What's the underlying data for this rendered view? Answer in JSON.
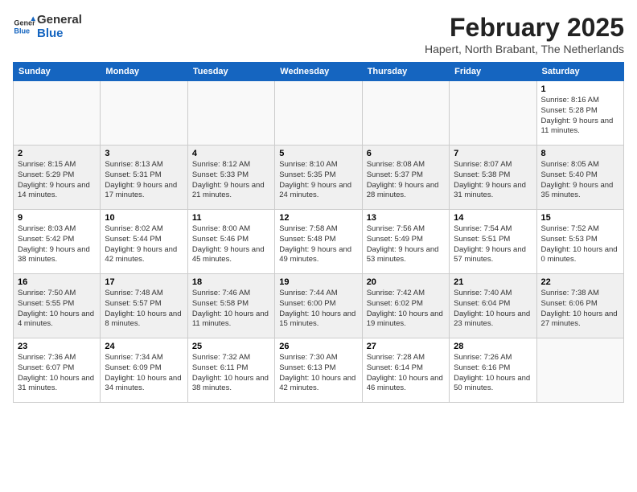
{
  "header": {
    "logo_line1": "General",
    "logo_line2": "Blue",
    "month_title": "February 2025",
    "location": "Hapert, North Brabant, The Netherlands"
  },
  "days_of_week": [
    "Sunday",
    "Monday",
    "Tuesday",
    "Wednesday",
    "Thursday",
    "Friday",
    "Saturday"
  ],
  "weeks": [
    [
      {
        "day": "",
        "info": ""
      },
      {
        "day": "",
        "info": ""
      },
      {
        "day": "",
        "info": ""
      },
      {
        "day": "",
        "info": ""
      },
      {
        "day": "",
        "info": ""
      },
      {
        "day": "",
        "info": ""
      },
      {
        "day": "1",
        "info": "Sunrise: 8:16 AM\nSunset: 5:28 PM\nDaylight: 9 hours and 11 minutes."
      }
    ],
    [
      {
        "day": "2",
        "info": "Sunrise: 8:15 AM\nSunset: 5:29 PM\nDaylight: 9 hours and 14 minutes."
      },
      {
        "day": "3",
        "info": "Sunrise: 8:13 AM\nSunset: 5:31 PM\nDaylight: 9 hours and 17 minutes."
      },
      {
        "day": "4",
        "info": "Sunrise: 8:12 AM\nSunset: 5:33 PM\nDaylight: 9 hours and 21 minutes."
      },
      {
        "day": "5",
        "info": "Sunrise: 8:10 AM\nSunset: 5:35 PM\nDaylight: 9 hours and 24 minutes."
      },
      {
        "day": "6",
        "info": "Sunrise: 8:08 AM\nSunset: 5:37 PM\nDaylight: 9 hours and 28 minutes."
      },
      {
        "day": "7",
        "info": "Sunrise: 8:07 AM\nSunset: 5:38 PM\nDaylight: 9 hours and 31 minutes."
      },
      {
        "day": "8",
        "info": "Sunrise: 8:05 AM\nSunset: 5:40 PM\nDaylight: 9 hours and 35 minutes."
      }
    ],
    [
      {
        "day": "9",
        "info": "Sunrise: 8:03 AM\nSunset: 5:42 PM\nDaylight: 9 hours and 38 minutes."
      },
      {
        "day": "10",
        "info": "Sunrise: 8:02 AM\nSunset: 5:44 PM\nDaylight: 9 hours and 42 minutes."
      },
      {
        "day": "11",
        "info": "Sunrise: 8:00 AM\nSunset: 5:46 PM\nDaylight: 9 hours and 45 minutes."
      },
      {
        "day": "12",
        "info": "Sunrise: 7:58 AM\nSunset: 5:48 PM\nDaylight: 9 hours and 49 minutes."
      },
      {
        "day": "13",
        "info": "Sunrise: 7:56 AM\nSunset: 5:49 PM\nDaylight: 9 hours and 53 minutes."
      },
      {
        "day": "14",
        "info": "Sunrise: 7:54 AM\nSunset: 5:51 PM\nDaylight: 9 hours and 57 minutes."
      },
      {
        "day": "15",
        "info": "Sunrise: 7:52 AM\nSunset: 5:53 PM\nDaylight: 10 hours and 0 minutes."
      }
    ],
    [
      {
        "day": "16",
        "info": "Sunrise: 7:50 AM\nSunset: 5:55 PM\nDaylight: 10 hours and 4 minutes."
      },
      {
        "day": "17",
        "info": "Sunrise: 7:48 AM\nSunset: 5:57 PM\nDaylight: 10 hours and 8 minutes."
      },
      {
        "day": "18",
        "info": "Sunrise: 7:46 AM\nSunset: 5:58 PM\nDaylight: 10 hours and 11 minutes."
      },
      {
        "day": "19",
        "info": "Sunrise: 7:44 AM\nSunset: 6:00 PM\nDaylight: 10 hours and 15 minutes."
      },
      {
        "day": "20",
        "info": "Sunrise: 7:42 AM\nSunset: 6:02 PM\nDaylight: 10 hours and 19 minutes."
      },
      {
        "day": "21",
        "info": "Sunrise: 7:40 AM\nSunset: 6:04 PM\nDaylight: 10 hours and 23 minutes."
      },
      {
        "day": "22",
        "info": "Sunrise: 7:38 AM\nSunset: 6:06 PM\nDaylight: 10 hours and 27 minutes."
      }
    ],
    [
      {
        "day": "23",
        "info": "Sunrise: 7:36 AM\nSunset: 6:07 PM\nDaylight: 10 hours and 31 minutes."
      },
      {
        "day": "24",
        "info": "Sunrise: 7:34 AM\nSunset: 6:09 PM\nDaylight: 10 hours and 34 minutes."
      },
      {
        "day": "25",
        "info": "Sunrise: 7:32 AM\nSunset: 6:11 PM\nDaylight: 10 hours and 38 minutes."
      },
      {
        "day": "26",
        "info": "Sunrise: 7:30 AM\nSunset: 6:13 PM\nDaylight: 10 hours and 42 minutes."
      },
      {
        "day": "27",
        "info": "Sunrise: 7:28 AM\nSunset: 6:14 PM\nDaylight: 10 hours and 46 minutes."
      },
      {
        "day": "28",
        "info": "Sunrise: 7:26 AM\nSunset: 6:16 PM\nDaylight: 10 hours and 50 minutes."
      },
      {
        "day": "",
        "info": ""
      }
    ]
  ]
}
